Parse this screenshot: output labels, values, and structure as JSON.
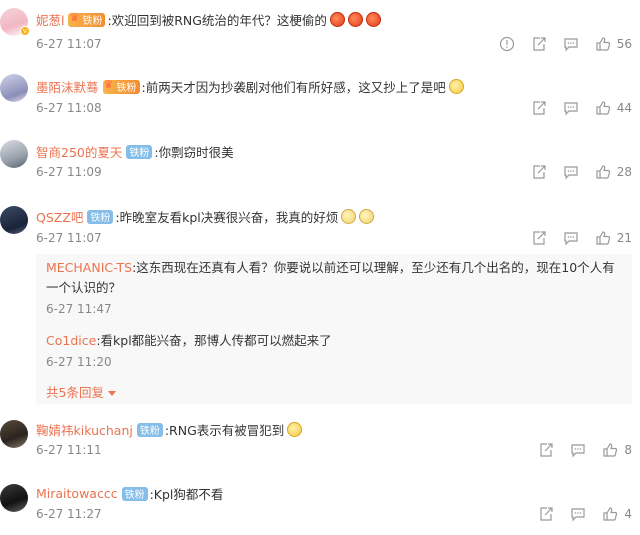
{
  "icons": {
    "report": "report-icon",
    "share": "share-icon",
    "comment": "comment-icon",
    "like": "like-icon"
  },
  "colors": {
    "username": "#eb7350",
    "fan_badge": "#83bde8",
    "muted": "#888888",
    "sub_bg": "#f8f8f8"
  },
  "comments": [
    {
      "username": "妮葱l",
      "badge": "铁粉",
      "text": ":欢迎回到被RNG统治的年代？这梗偷的",
      "time": "6-27 11:07",
      "likes": "56"
    },
    {
      "username": "墨陌沫默蓦",
      "badge": "铁粉",
      "text": ":前两天才因为抄袭剧对他们有所好感，这又抄上了是吧",
      "time": "6-27 11:08",
      "likes": "44"
    },
    {
      "username": "智商250的夏天",
      "badge": "铁粉",
      "text": ":你剽窃时很美",
      "time": "6-27 11:09",
      "likes": "28"
    },
    {
      "username": "QSZZ吧",
      "badge": "铁粉",
      "text": ":昨晚室友看kpl决赛很兴奋，我真的好烦",
      "time": "6-27 11:07",
      "likes": "21",
      "replies": [
        {
          "username": "MECHANIC-TS",
          "text_line1": ":这东西现在还真有人看？你要说以前还可以理解，至少还有几个出名的，现在10个人有",
          "text_line2": "一个认识的？",
          "time": "6-27 11:47"
        },
        {
          "username": "Co1dice",
          "text_line1": ":看kpl都能兴奋，那博人传都可以燃起来了",
          "time": "6-27 11:20"
        }
      ],
      "more_replies": "共5条回复"
    },
    {
      "username": "鞠婧祎kikuchanj",
      "badge": "铁粉",
      "text": ":RNG表示有被冒犯到",
      "time": "6-27 11:11",
      "likes": "8"
    },
    {
      "username": "Miraitowaccc",
      "badge": "铁粉",
      "text": ":Kpl狗都不看",
      "time": "6-27 11:27",
      "likes": "4"
    }
  ]
}
